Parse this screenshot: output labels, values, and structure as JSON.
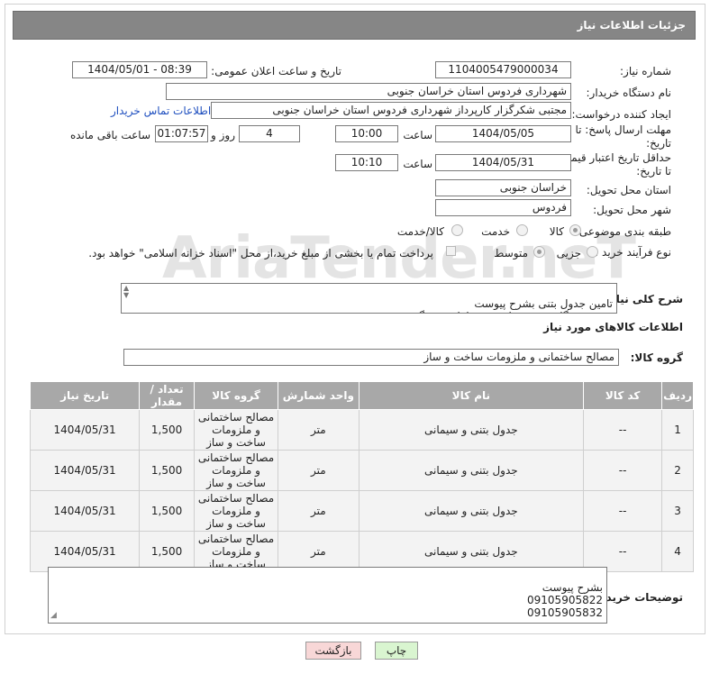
{
  "header": {
    "title": "جزئیات اطلاعات نیاز"
  },
  "watermark": "AriaTender.neT",
  "fields": {
    "need_number_label": "شماره نیاز:",
    "need_number": "1104005479000034",
    "announce_label": "تاریخ و ساعت اعلان عمومی:",
    "announce_value": "1404/05/01 - 08:39",
    "buyer_org_label": "نام دستگاه خریدار:",
    "buyer_org": "شهرداری فردوس استان خراسان جنوبی",
    "creator_label": "ایجاد کننده درخواست:",
    "creator": "مجتبی شکرگزار کارپرداز شهرداری فردوس استان خراسان جنوبی",
    "contact_link": "اطلاعات تماس خریدار",
    "deadline_label_1": "مهلت ارسال پاسخ: تا",
    "deadline_label_2": "تاریخ:",
    "deadline_date": "1404/05/05",
    "time_label": "ساعت",
    "deadline_time": "10:00",
    "days_value": "4",
    "days_label": "روز و",
    "remaining_time": "01:07:57",
    "remaining_label": "ساعت باقی مانده",
    "validity_label_1": "حداقل تاریخ اعتبار قیمت:",
    "validity_label_2": "تا تاریخ:",
    "validity_date": "1404/05/31",
    "validity_time": "10:10",
    "province_label": "استان محل تحویل:",
    "province": "خراسان جنوبی",
    "city_label": "شهر محل تحویل:",
    "city": "فردوس",
    "category_label": "طبقه بندی موضوعی:",
    "category_options": [
      "کالا",
      "خدمت",
      "کالا/خدمت"
    ],
    "process_label": "نوع فرآیند خرید :",
    "process_options": [
      "جزیی",
      "متوسط"
    ],
    "payment_note": "پرداخت تمام یا بخشی از مبلغ خرید،از محل \"اسناد خزانه اسلامی\" خواهد بود.",
    "summary_label": "شرح کلی نیاز:",
    "summary_text": "تامین جدول بتنی بشرح پیوست\nتوجه:درهنگام درج به واحد متر طول توجه گردد.",
    "goods_info_title": "اطلاعات کالاهای مورد نیاز",
    "goods_group_label": "گروه کالا:",
    "goods_group": "مصالح ساختمانی و ملزومات ساخت و ساز",
    "buyer_notes_label": "توضیحات خریدار:",
    "buyer_notes": "بشرح پیوست\n09105905822\n09105905832"
  },
  "table": {
    "headers": [
      "ردیف",
      "کد کالا",
      "نام کالا",
      "واحد شمارش",
      "گروه کالا",
      "تعداد / مقدار",
      "تاریخ نیاز"
    ],
    "rows": [
      [
        "1",
        "--",
        "جدول بتنی و سیمانی",
        "متر",
        "مصالح ساختمانی و ملزومات ساخت و ساز",
        "1,500",
        "1404/05/31"
      ],
      [
        "2",
        "--",
        "جدول بتنی و سیمانی",
        "متر",
        "مصالح ساختمانی و ملزومات ساخت و ساز",
        "1,500",
        "1404/05/31"
      ],
      [
        "3",
        "--",
        "جدول بتنی و سیمانی",
        "متر",
        "مصالح ساختمانی و ملزومات ساخت و ساز",
        "1,500",
        "1404/05/31"
      ],
      [
        "4",
        "--",
        "جدول بتنی و سیمانی",
        "متر",
        "مصالح ساختمانی و ملزومات ساخت و ساز",
        "1,500",
        "1404/05/31"
      ]
    ]
  },
  "buttons": {
    "print": "چاپ",
    "back": "بازگشت"
  },
  "colors": {
    "header_bg": "#868686",
    "link": "#1f4fbf",
    "print_bg": "#d9f5d0",
    "back_bg": "#f8d7d7"
  }
}
